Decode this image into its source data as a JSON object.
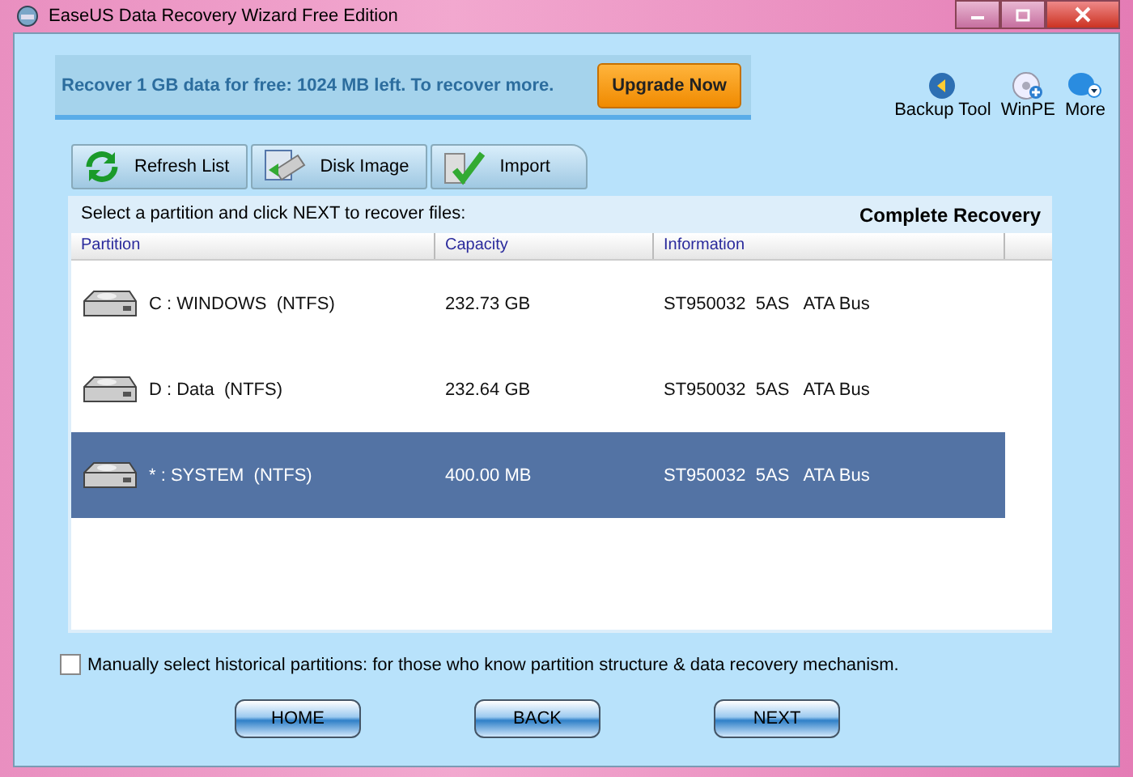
{
  "window": {
    "title": "EaseUS Data Recovery Wizard Free Edition"
  },
  "banner": {
    "message": "Recover 1 GB data for free: 1024 MB left. To recover more.",
    "button": "Upgrade Now"
  },
  "tools": [
    {
      "label": "Backup Tool",
      "kind": "backup"
    },
    {
      "label": "WinPE",
      "kind": "winpe"
    },
    {
      "label": "More",
      "kind": "more"
    }
  ],
  "toolbar": [
    {
      "label": "Refresh List",
      "kind": "refresh"
    },
    {
      "label": "Disk Image",
      "kind": "image"
    },
    {
      "label": "Import",
      "kind": "import"
    }
  ],
  "panel": {
    "instruction": "Select a partition and click NEXT to recover files:",
    "mode": "Complete Recovery"
  },
  "table": {
    "columns": [
      "Partition",
      "Capacity",
      "Information"
    ],
    "rows": [
      {
        "partition": "C : WINDOWS  (NTFS)",
        "capacity": "232.73 GB",
        "information": "ST950032  5AS   ATA Bus",
        "selected": false
      },
      {
        "partition": "D : Data  (NTFS)",
        "capacity": "232.64 GB",
        "information": "ST950032  5AS   ATA Bus",
        "selected": false
      },
      {
        "partition": "* : SYSTEM  (NTFS)",
        "capacity": "400.00 MB",
        "information": "ST950032  5AS   ATA Bus",
        "selected": true
      }
    ]
  },
  "historical": {
    "label": "Manually select historical partitions: for those who know partition structure & data recovery mechanism.",
    "checked": false
  },
  "buttons": [
    "HOME",
    "BACK",
    "NEXT"
  ]
}
